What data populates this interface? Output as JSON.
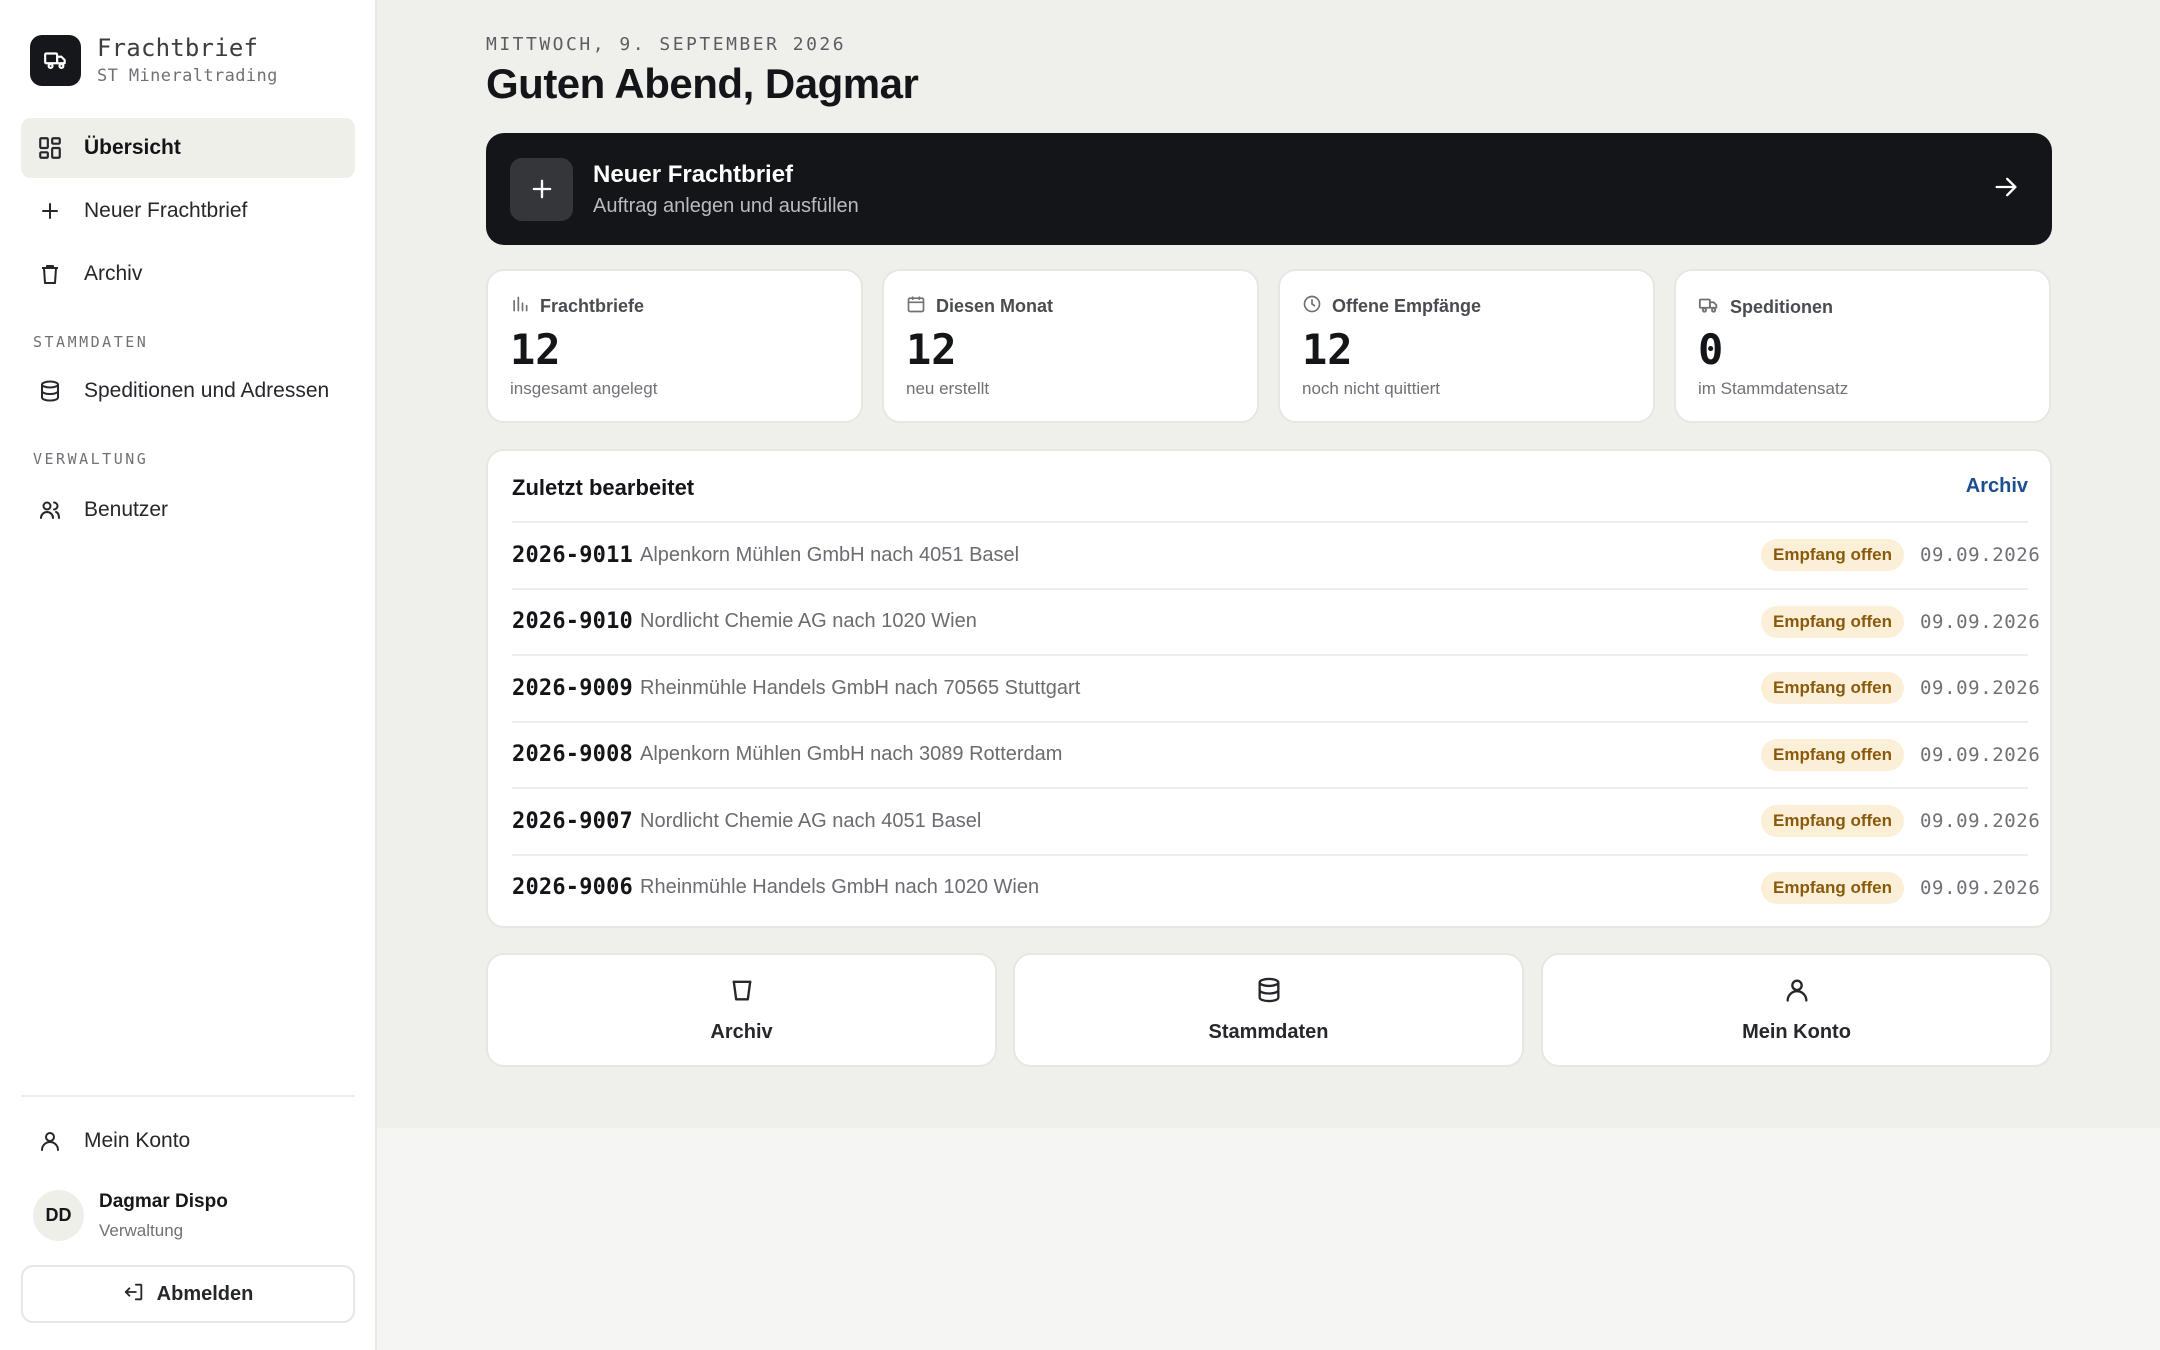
{
  "brand": {
    "name": "Frachtbrief",
    "subtitle": "ST Mineraltrading",
    "logo_icon": "truck-icon"
  },
  "sidebar": {
    "nav": [
      {
        "label": "Übersicht",
        "icon": "dashboard-icon",
        "active": true
      },
      {
        "label": "Neuer Frachtbrief",
        "icon": "plus-icon"
      },
      {
        "label": "Archiv",
        "icon": "archive-icon"
      }
    ],
    "section_stammdaten": "STAMMDATEN",
    "stammdaten_items": [
      {
        "label": "Speditionen und Adressen",
        "icon": "database-icon"
      }
    ],
    "section_verwaltung": "VERWALTUNG",
    "verwaltung_items": [
      {
        "label": "Benutzer",
        "icon": "users-icon"
      }
    ],
    "account": {
      "label": "Mein Konto",
      "icon": "user-icon"
    },
    "user": {
      "initials": "DD",
      "name": "Dagmar Dispo",
      "role": "Verwaltung"
    },
    "logout_label": "Abmelden"
  },
  "header": {
    "date": "MITTWOCH, 9. SEPTEMBER 2026",
    "greeting": "Guten Abend, Dagmar"
  },
  "cta": {
    "title": "Neuer Frachtbrief",
    "subtitle": "Auftrag anlegen und ausfüllen"
  },
  "stats": [
    {
      "label": "Frachtbriefe",
      "value": "12",
      "sub": "insgesamt angelegt",
      "icon": "bar-chart-icon"
    },
    {
      "label": "Diesen Monat",
      "value": "12",
      "sub": "neu erstellt",
      "icon": "calendar-icon"
    },
    {
      "label": "Offene Empfänge",
      "value": "12",
      "sub": "noch nicht quittiert",
      "icon": "clock-icon"
    },
    {
      "label": "Speditionen",
      "value": "0",
      "sub": "im Stammdatensatz",
      "icon": "truck-icon"
    }
  ],
  "recent": {
    "title": "Zuletzt bearbeitet",
    "link": "Archiv",
    "rows": [
      {
        "id": "2026-9011",
        "desc": "Alpenkorn Mühlen GmbH nach 4051 Basel",
        "status": "Empfang offen",
        "date": "09.09.2026"
      },
      {
        "id": "2026-9010",
        "desc": "Nordlicht Chemie AG nach 1020 Wien",
        "status": "Empfang offen",
        "date": "09.09.2026"
      },
      {
        "id": "2026-9009",
        "desc": "Rheinmühle Handels GmbH nach 70565 Stuttgart",
        "status": "Empfang offen",
        "date": "09.09.2026"
      },
      {
        "id": "2026-9008",
        "desc": "Alpenkorn Mühlen GmbH nach 3089 Rotterdam",
        "status": "Empfang offen",
        "date": "09.09.2026"
      },
      {
        "id": "2026-9007",
        "desc": "Nordlicht Chemie AG nach 4051 Basel",
        "status": "Empfang offen",
        "date": "09.09.2026"
      },
      {
        "id": "2026-9006",
        "desc": "Rheinmühle Handels GmbH nach 1020 Wien",
        "status": "Empfang offen",
        "date": "09.09.2026"
      }
    ]
  },
  "tiles": [
    {
      "label": "Archiv",
      "icon": "archive-icon"
    },
    {
      "label": "Stammdaten",
      "icon": "database-icon"
    },
    {
      "label": "Mein Konto",
      "icon": "user-icon"
    }
  ],
  "colors": {
    "accent_dark": "#141518",
    "link": "#1d4e8f",
    "badge_bg": "#fcefd7",
    "badge_text": "#8a5a0c"
  }
}
